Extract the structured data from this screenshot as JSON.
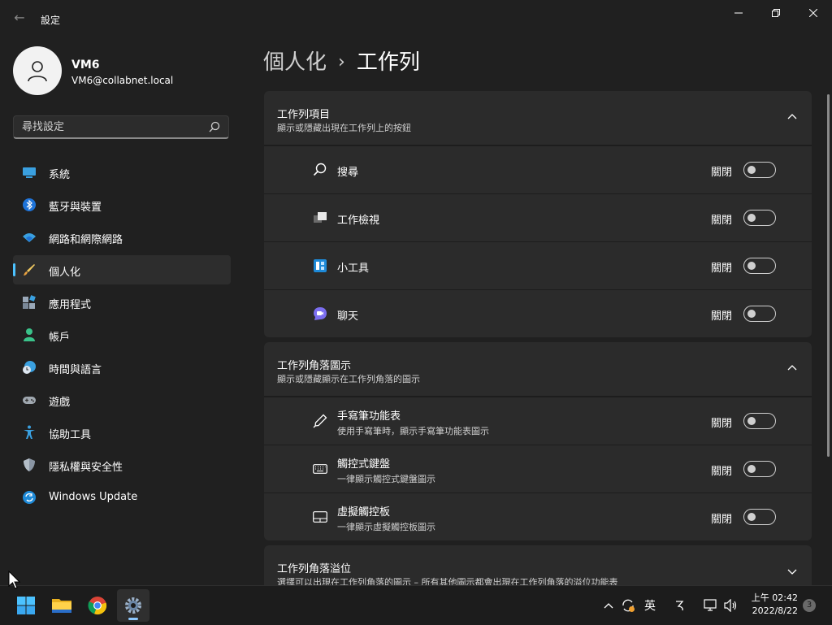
{
  "window": {
    "title": "設定",
    "back_label": "←"
  },
  "user": {
    "name": "VM6",
    "email": "VM6@collabnet.local"
  },
  "search": {
    "placeholder": "尋找設定",
    "value": ""
  },
  "sidebar": {
    "items": [
      {
        "label": "系統",
        "icon": "system-monitor-icon"
      },
      {
        "label": "藍牙與裝置",
        "icon": "bluetooth-icon"
      },
      {
        "label": "網路和網際網路",
        "icon": "wifi-icon"
      },
      {
        "label": "個人化",
        "icon": "paintbrush-icon",
        "selected": true
      },
      {
        "label": "應用程式",
        "icon": "apps-icon"
      },
      {
        "label": "帳戶",
        "icon": "person-icon"
      },
      {
        "label": "時間與語言",
        "icon": "globe-clock-icon"
      },
      {
        "label": "遊戲",
        "icon": "gamepad-icon"
      },
      {
        "label": "協助工具",
        "icon": "accessibility-icon"
      },
      {
        "label": "隱私權與安全性",
        "icon": "shield-icon"
      },
      {
        "label": "Windows Update",
        "icon": "update-icon"
      }
    ]
  },
  "breadcrumb": {
    "parent": "個人化",
    "separator": "›",
    "current": "工作列"
  },
  "groups": {
    "taskbar_items": {
      "title": "工作列項目",
      "description": "顯示或隱藏出現在工作列上的按鈕",
      "rows": [
        {
          "label": "搜尋",
          "state": "關閉",
          "icon": "search-icon"
        },
        {
          "label": "工作檢視",
          "state": "關閉",
          "icon": "task-view-icon"
        },
        {
          "label": "小工具",
          "state": "關閉",
          "icon": "widgets-icon"
        },
        {
          "label": "聊天",
          "state": "關閉",
          "icon": "chat-icon"
        }
      ]
    },
    "corner_icons": {
      "title": "工作列角落圖示",
      "description": "顯示或隱藏顯示在工作列角落的圖示",
      "rows": [
        {
          "label": "手寫筆功能表",
          "sublabel": "使用手寫筆時，顯示手寫筆功能表圖示",
          "state": "關閉",
          "icon": "pen-icon"
        },
        {
          "label": "觸控式鍵盤",
          "sublabel": "一律顯示觸控式鍵盤圖示",
          "state": "關閉",
          "icon": "keyboard-icon"
        },
        {
          "label": "虛擬觸控板",
          "sublabel": "一律顯示虛擬觸控板圖示",
          "state": "關閉",
          "icon": "touchpad-icon"
        }
      ]
    },
    "corner_overflow": {
      "title": "工作列角落溢位",
      "description": "選擇可以出現在工作列角落的圖示 – 所有其他圖示都會出現在工作列角落的溢位功能表"
    }
  },
  "taskbar": {
    "apps": [
      "start-icon",
      "file-explorer-icon",
      "chrome-icon",
      "settings-icon"
    ],
    "tray": {
      "chevron": "^",
      "ime": "英",
      "clock_time": "上午 02:42",
      "clock_date": "2022/8/22",
      "notification_count": "3"
    }
  },
  "colors": {
    "accent": "#4cc2ff",
    "background": "#202020",
    "card": "#2b2b2b"
  }
}
